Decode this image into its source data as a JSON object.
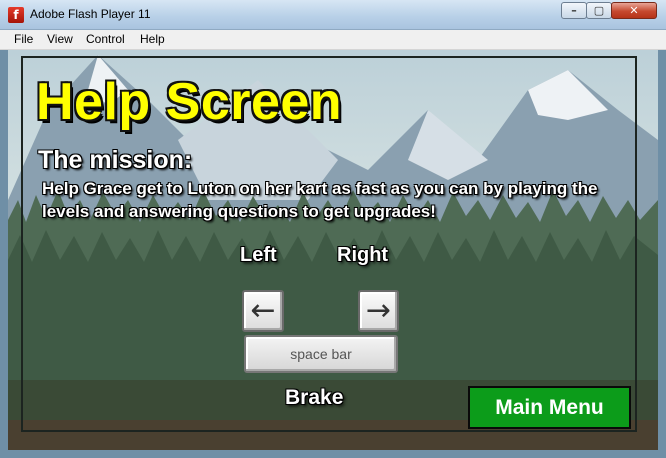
{
  "window": {
    "title": "Adobe Flash Player 11",
    "app_icon": "flash-icon",
    "min_glyph": "–",
    "max_glyph": "▢",
    "close_glyph": "✕"
  },
  "menu": {
    "items": [
      "File",
      "View",
      "Control",
      "Help"
    ]
  },
  "game": {
    "title": "Help Screen",
    "mission_heading": "The mission:",
    "mission_text": "Help Grace get to Luton on her kart as fast as you can by playing the levels and answering questions to get upgrades!",
    "controls": {
      "left_label": "Left",
      "right_label": "Right",
      "left_key_glyph": "←",
      "right_key_glyph": "→",
      "space_key_label": "space bar",
      "brake_label": "Brake"
    },
    "main_menu_label": "Main Menu"
  },
  "colors": {
    "title_yellow": "#ffff00",
    "main_menu_green": "#0c9c1a"
  }
}
